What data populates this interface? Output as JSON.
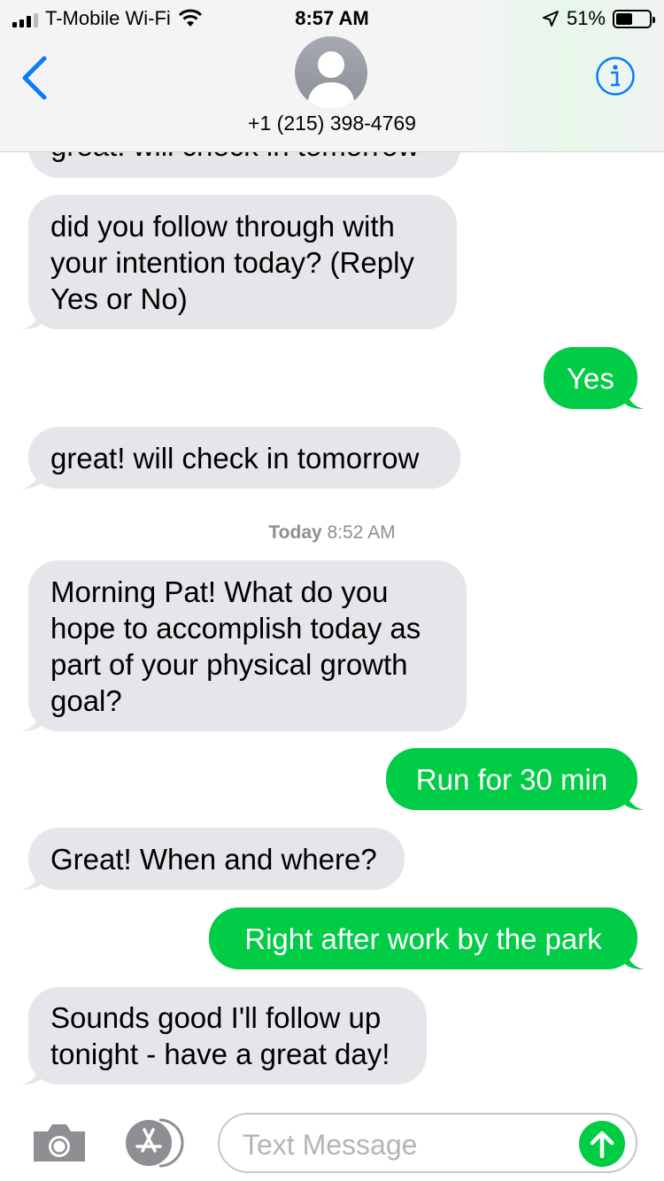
{
  "status_bar": {
    "carrier": "T-Mobile Wi-Fi",
    "time": "8:57 AM",
    "battery_percent": "51%",
    "battery_level": 0.51
  },
  "header": {
    "contact": "+1 (215) 398-4769",
    "back_icon": "chevron-left-icon",
    "info_icon": "info-icon",
    "avatar_icon": "person-silhouette-icon"
  },
  "thread": {
    "clipped_message": "great! will check in tomorrow",
    "messages": [
      {
        "dir": "in",
        "text": "did you follow through with\nyour intention today? (Reply\nYes or No)"
      },
      {
        "dir": "out",
        "text": "Yes"
      },
      {
        "dir": "in",
        "text": "great! will check in tomorrow"
      },
      {
        "dir": "in",
        "text": "Morning Pat! What do you\nhope to accomplish today as\npart of your physical growth\ngoal?"
      },
      {
        "dir": "out",
        "text": "Run for 30 min"
      },
      {
        "dir": "in",
        "text": "Great! When and where?"
      },
      {
        "dir": "out",
        "text": "Right after work by the park"
      },
      {
        "dir": "in",
        "text": "Sounds good I'll follow up\ntonight - have a great day!"
      }
    ],
    "timestamp_day": "Today",
    "timestamp_time": "8:52 AM"
  },
  "compose": {
    "placeholder": "Text Message",
    "camera_icon": "camera-icon",
    "apps_icon": "app-store-icon",
    "send_icon": "send-arrow-icon"
  },
  "colors": {
    "incoming": "#e5e5ea",
    "outgoing": "#00cc45",
    "accent": "#0a7aff"
  }
}
